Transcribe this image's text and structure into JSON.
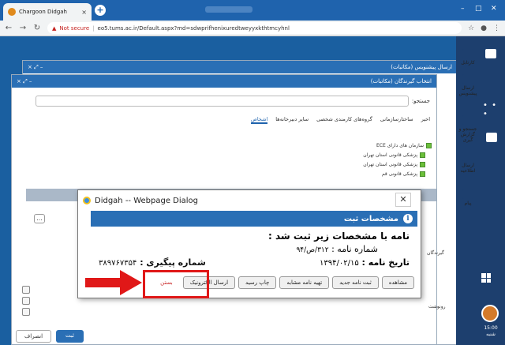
{
  "browser": {
    "tab_title": "Chargoon Didgah",
    "tab_close": "×",
    "new_tab": "+",
    "window_controls": [
      "–",
      "□",
      "✕"
    ],
    "security_label": "Not secure",
    "url": "eo5.tums.ac.ir/Default.aspx?md=sdwprifhenixuredtweyyxkthtmcyhnl"
  },
  "sidebar": {
    "items": [
      {
        "label": "کارتابل",
        "icon": "inbox-icon"
      },
      {
        "label": "ارسال پیشنویس",
        "icon": "briefcase-icon"
      },
      {
        "label": "جستجو و گزارش گیری",
        "icon": "search-report-icon"
      },
      {
        "label": "ارسال اطلاعیه",
        "icon": "document-icon"
      },
      {
        "label": "پیام",
        "icon": "chat-icon"
      }
    ],
    "dots": "• • •",
    "clock_time": "15:00",
    "clock_day": "شنبه"
  },
  "back_window": {
    "title": "ارسال پیشنویس (مکاتبات)",
    "controls": "× ⤢ –"
  },
  "front_window": {
    "title": "انتخاب گیرندگان (مکاتبات)",
    "controls": "× ⤢ –",
    "search_label": "جستجو:",
    "tabs": [
      "اخیر",
      "ساختارسازمانی",
      "گروه‌های کارمندی شخصی",
      "سایر دبیرخانه‌ها",
      "اشخاص"
    ],
    "active_tab": "اشخاص",
    "tree": [
      "سازمان های دارای ECE",
      "پزشکی قانونی استان تهران",
      "پزشکی قانونی استان تهران",
      "پزشکی قانونی قم"
    ],
    "side_labels": [
      "گیرندگان",
      "رونوشت"
    ],
    "submit_label": "ثبت",
    "cancel_label": "انصراف"
  },
  "dialog": {
    "title": "Didgah -- Webpage Dialog",
    "close": "✕",
    "header": "مشخصات ثبت",
    "info_icon": "i",
    "message": "نامه با مشخصات زیر ثبت شد :",
    "letter_number_label": "شماره نامه :",
    "letter_number_value": "۳۱۲/ص/۹۴",
    "letter_date_label": "تاریخ نامه :",
    "letter_date_value": "۱۳۹۴/۰۲/۱۵",
    "tracking_label": "شماره پیگیری :",
    "tracking_value": "۳۸۹۷۶۷۳۵۴",
    "buttons": [
      "مشاهده",
      "ثبت نامه جدید",
      "تهیه نامه مشابه",
      "چاپ رسید",
      "ارسال الکترونیک",
      "بستن"
    ],
    "highlighted_button": "ارسال الکترونیک"
  },
  "colors": {
    "accent": "#2a6fb5",
    "annotation": "#e01818"
  }
}
